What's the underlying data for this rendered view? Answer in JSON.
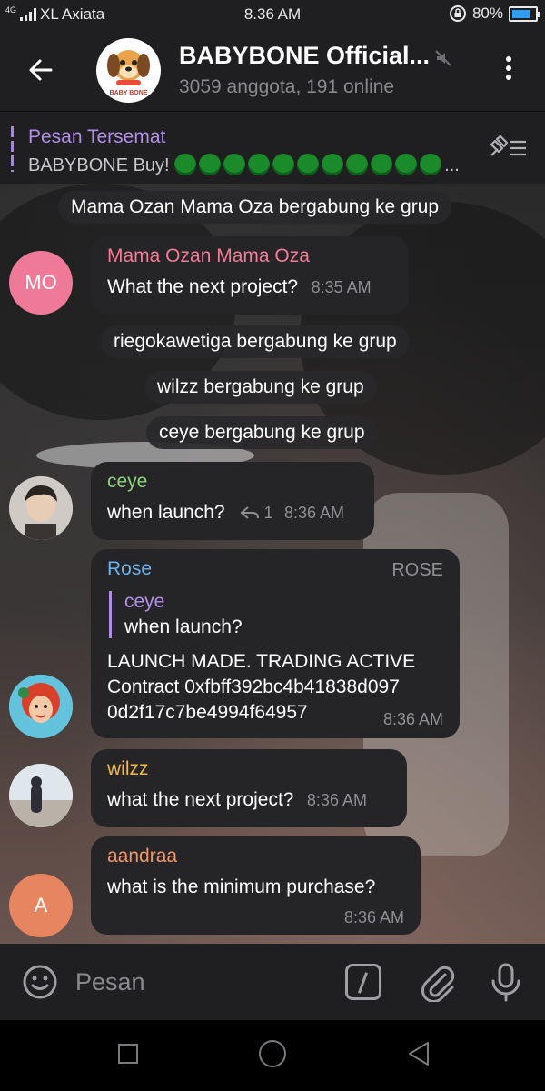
{
  "status": {
    "network": "4G",
    "carrier": "XL Axiata",
    "time": "8.36 AM",
    "battery": "80%",
    "battery_level": 0.8
  },
  "header": {
    "title": "BABYBONE Official...",
    "subtitle": "3059 anggota, 191 online",
    "avatar_text": "BABY BONE"
  },
  "pinned": {
    "title": "Pesan Tersemat",
    "text": "BABYBONE Buy!",
    "dot_count": 11,
    "ellipsis": "..."
  },
  "messages": {
    "sys1": "Mama Ozan Mama Oza bergabung ke grup",
    "m1": {
      "name": "Mama Ozan Mama Oza",
      "name_color": "#f27b96",
      "text": "What the next project?",
      "time": "8:35 AM",
      "avatar": "MO",
      "avatar_color": "#ef7a97"
    },
    "sys2": "riegokawetiga bergabung ke grup",
    "sys3": "wilzz bergabung ke grup",
    "sys4": "ceye bergabung ke grup",
    "m2": {
      "name": "ceye",
      "name_color": "#8ed37d",
      "text": "when launch?",
      "replies": "1",
      "time": "8:36 AM"
    },
    "m3": {
      "name": "Rose",
      "name_color": "#6cb3ec",
      "badge": "ROSE",
      "reply_name": "ceye",
      "reply_text": "when launch?",
      "line1": "LAUNCH MADE. TRADING ACTIVE",
      "line2": "Contract 0xfbff392bc4b41838d097",
      "line3": "0d2f17c7be4994f64957",
      "time": "8:36 AM"
    },
    "m4": {
      "name": "wilzz",
      "name_color": "#f2b64a",
      "text": "what the next project?",
      "time": "8:36 AM"
    },
    "m5": {
      "name": "aandraa",
      "name_color": "#f0956b",
      "text": "what is the minimum purchase?",
      "time": "8:36 AM",
      "avatar": "A",
      "avatar_color": "#e88561"
    }
  },
  "input": {
    "placeholder": "Pesan"
  },
  "icons": {
    "back": "arrow-left-icon",
    "mute": "mute-icon",
    "menu": "more-vertical-icon",
    "pin": "pin-list-icon",
    "emoji": "emoji-icon",
    "commands": "bot-command-icon",
    "attach": "paperclip-icon",
    "mic": "microphone-icon",
    "reply": "reply-icon"
  }
}
